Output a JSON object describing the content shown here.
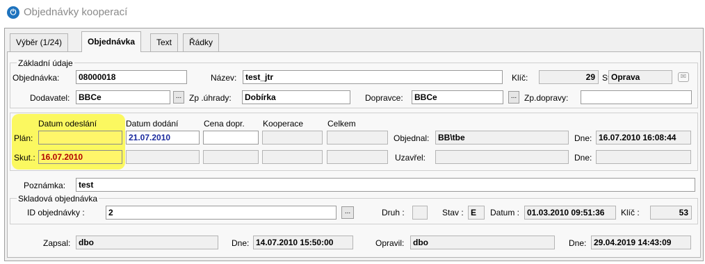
{
  "window": {
    "title": "Objednávky kooperací"
  },
  "tabs": [
    "Výběr (1/24)",
    "Objednávka",
    "Text",
    "Řádky"
  ],
  "basic": {
    "legend": "Základní údaje",
    "order_label": "Objednávka:",
    "order_value": "08000018",
    "name_label": "Název:",
    "name_value": "test_jtr",
    "key_label": "Klíč:",
    "key_value": "29",
    "state_label": "Stav:",
    "state_value": "Oprava",
    "supplier_label": "Dodavatel:",
    "supplier_value": "BBCe",
    "payment_label": "Zp .úhrady:",
    "payment_value": "Dobírka",
    "carrier_label": "Dopravce:",
    "carrier_value": "BBCe",
    "transport_label": "Zp.dopravy:",
    "transport_value": "",
    "button_ellipsis": "..."
  },
  "dates": {
    "col_sent": "Datum odeslání",
    "col_delivery": "Datum dodání",
    "col_transport_price": "Cena dopr.",
    "col_cooperation": "Kooperace",
    "col_total": "Celkem",
    "plan_label": "Plán:",
    "plan_delivery": "21.07.2010",
    "actual_label": "Skut.:",
    "actual_sent": "16.07.2010",
    "ordered_label": "Objednal:",
    "ordered_value": "BB\\tbe",
    "closed_label": "Uzavřel:",
    "closed_value": "",
    "date1_label": "Dne:",
    "date1_value": "16.07.2010 16:08:44",
    "date2_label": "Dne:",
    "date2_value": ""
  },
  "note": {
    "label": "Poznámka:",
    "value": "test"
  },
  "warehouse": {
    "legend": "Skladová objednávka",
    "id_label": "ID objednávky :",
    "id_value": "2",
    "kind_label": "Druh :",
    "kind_value": "",
    "state_label": "Stav :",
    "state_value": "E",
    "date_label": "Datum :",
    "date_value": "01.03.2010 09:51:36",
    "key_label": "Klíč :",
    "key_value": "53"
  },
  "audit": {
    "created_label": "Zapsal:",
    "created_value": "dbo",
    "created_date_label": "Dne:",
    "created_date_value": "14.07.2010 15:50:00",
    "modified_label": "Opravil:",
    "modified_value": "dbo",
    "modified_date_label": "Dne:",
    "modified_date_value": "29.04.2019 14:43:09"
  },
  "colors": {
    "highlight": "#fbf860",
    "blue_text": "#1a2a9e",
    "red_text": "#b00000"
  }
}
